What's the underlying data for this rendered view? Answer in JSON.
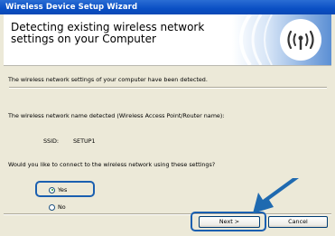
{
  "window": {
    "title": "Wireless Device Setup Wizard"
  },
  "header": {
    "title_line1": "Detecting existing wireless network",
    "title_line2": "settings on your Computer",
    "icon": "wifi-antenna-icon"
  },
  "content": {
    "detected_text": "The wireless network settings of your computer have been detected.",
    "network_name_label": "The wireless network name detected (Wireless Access Point/Router name):",
    "ssid_label": "SSID:",
    "ssid_value": "SETUP1",
    "question": "Would you like to connect to the wireless network using these settings?",
    "options": [
      {
        "label": "Yes",
        "selected": true
      },
      {
        "label": "No",
        "selected": false
      }
    ]
  },
  "buttons": {
    "next": "Next >",
    "cancel": "Cancel"
  },
  "colors": {
    "titlebar": "#0a4fc4",
    "highlight": "#1a5fb0",
    "arrow": "#1f6ab0"
  }
}
